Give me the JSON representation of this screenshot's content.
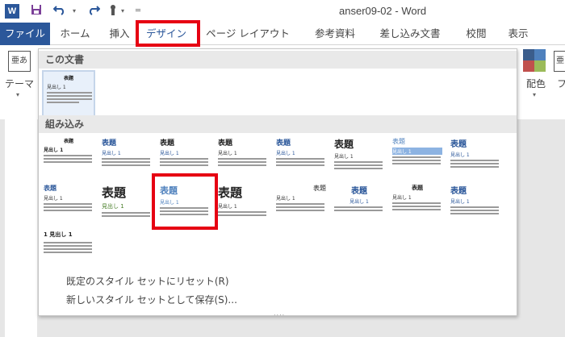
{
  "titlebar": {
    "app_icon": "W",
    "document_title": "anser09-02 - Word",
    "save_icon": "save-icon",
    "undo_icon": "undo-icon",
    "redo_icon": "redo-icon",
    "touch_icon": "touch-mode-icon"
  },
  "tabs": [
    {
      "label": "ファイル"
    },
    {
      "label": "ホーム"
    },
    {
      "label": "挿入"
    },
    {
      "label": "デザイン"
    },
    {
      "label": "ページ レイアウト"
    },
    {
      "label": "参考資料"
    },
    {
      "label": "差し込み文書"
    },
    {
      "label": "校閲"
    },
    {
      "label": "表示"
    }
  ],
  "ribbon": {
    "theme_label": "テーマ",
    "theme_icon_text": "亜あ",
    "color_label": "配色",
    "font_label": "フ",
    "font_icon_text": "亜"
  },
  "gallery": {
    "section_this_doc": "この文書",
    "section_builtin": "組み込み",
    "thumb_title": "表題",
    "thumb_heading": "見出し 1",
    "thumb_heading_numbered": "1 見出し 1",
    "reset_item": "既定のスタイル セットにリセット(R)",
    "save_item": "新しいスタイル セットとして保存(S)...",
    "resize_handle": "....",
    "highlight_color": "#e60012"
  }
}
